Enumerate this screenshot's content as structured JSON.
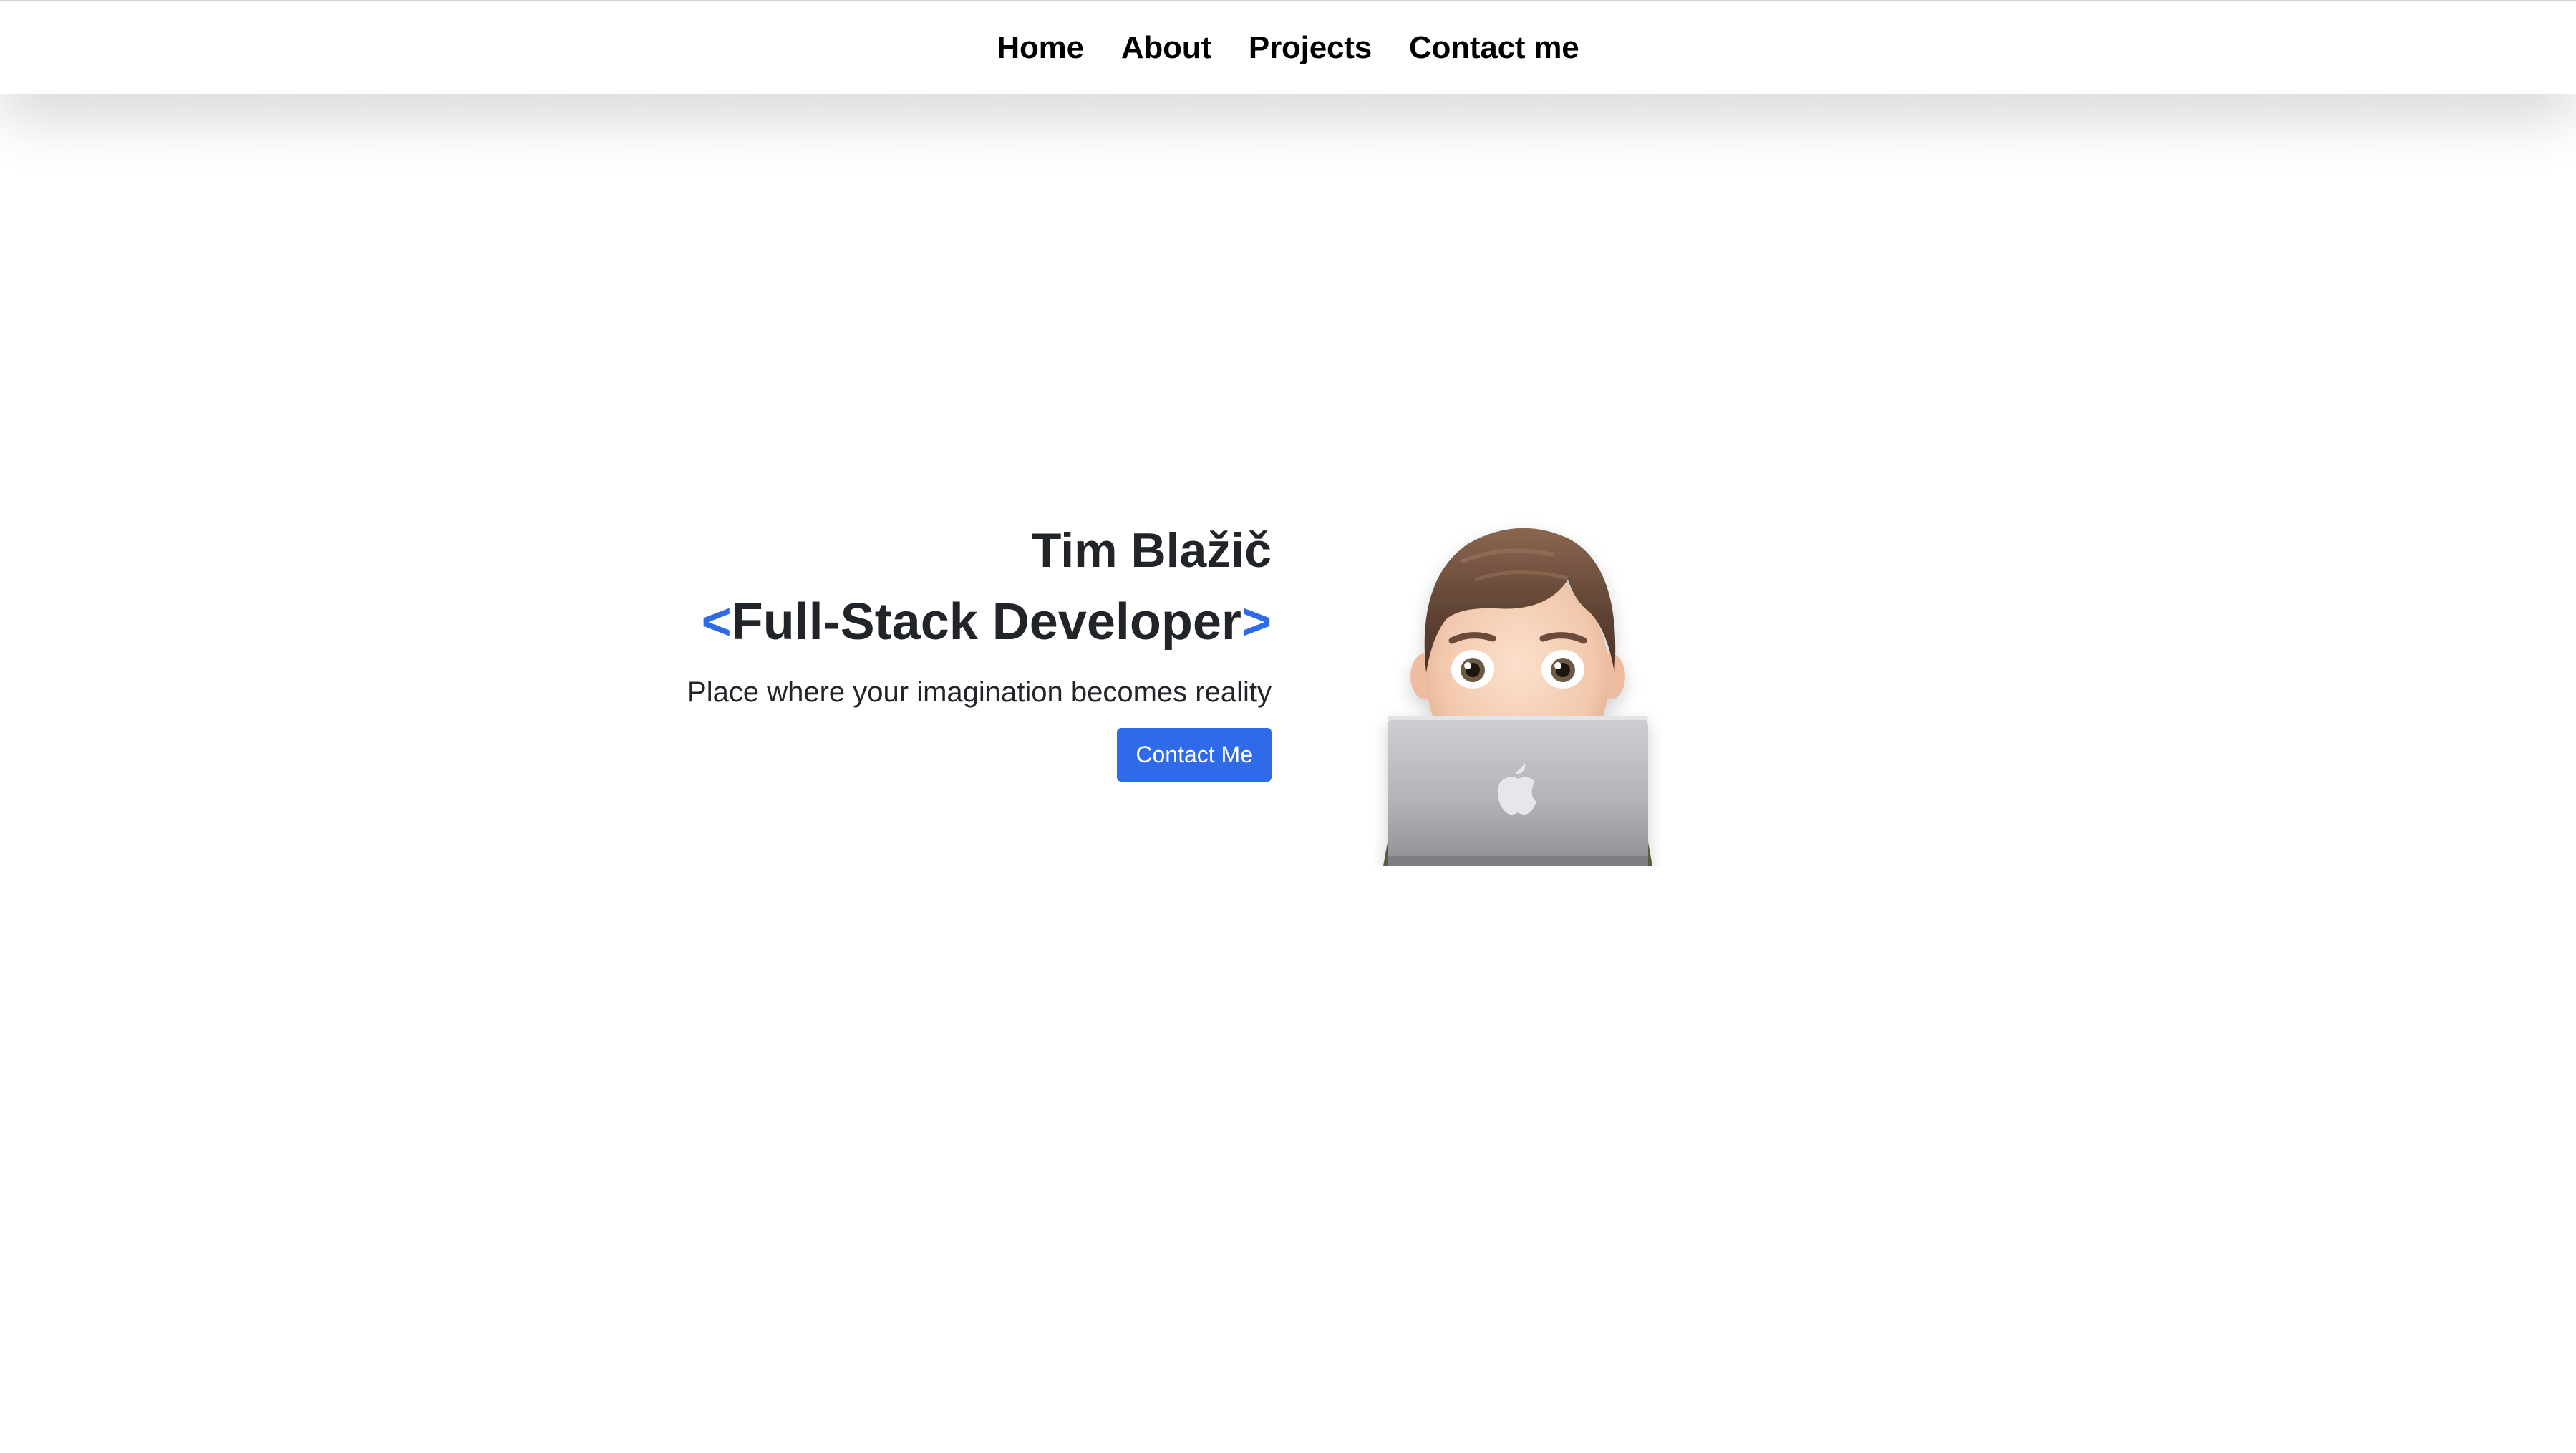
{
  "nav": {
    "items": [
      {
        "label": "Home"
      },
      {
        "label": "About"
      },
      {
        "label": "Projects"
      },
      {
        "label": "Contact me"
      }
    ]
  },
  "hero": {
    "name": "Tim Blažič",
    "role_open": "<",
    "role": "Full-Stack Developer",
    "role_close": ">",
    "tagline": "Place where your imagination becomes reality",
    "button_label": "Contact Me"
  },
  "avatar": {
    "icon": "memoji-with-laptop"
  },
  "colors": {
    "accent": "#2f6ae8",
    "text": "#212529",
    "nav_text": "#000000",
    "background": "#ffffff"
  }
}
